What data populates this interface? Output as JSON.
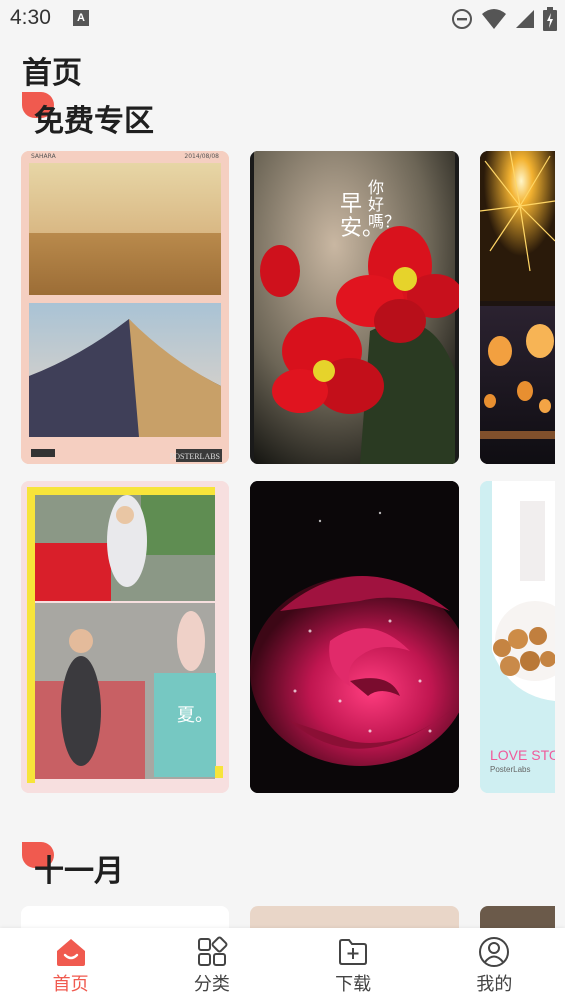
{
  "status_bar": {
    "time": "4:30",
    "left_icon": "A",
    "icons": [
      "do-not-disturb-icon",
      "wifi-icon",
      "signal-icon",
      "battery-charging-icon"
    ]
  },
  "page": {
    "title": "首页"
  },
  "sections": [
    {
      "title": "免费专区",
      "cards": [
        {
          "name": "desert-poster",
          "brand_text": "POSTERLABS",
          "header_left": "SAHARA",
          "header_right": "2014/08/08"
        },
        {
          "name": "red-flower-poster",
          "text_line1": "你好嗎？",
          "text_line2": "早安。"
        },
        {
          "name": "sparkler-lantern-poster"
        },
        {
          "name": "summer-street-poster",
          "text": "夏。"
        },
        {
          "name": "rose-poster"
        },
        {
          "name": "love-story-poster",
          "text_title": "LOVE STO",
          "text_sub": "PosterLabs"
        }
      ]
    },
    {
      "title": "十一月"
    }
  ],
  "bottom_nav": [
    {
      "label": "首页",
      "icon": "home-icon",
      "active": true
    },
    {
      "label": "分类",
      "icon": "category-grid-icon",
      "active": false
    },
    {
      "label": "下载",
      "icon": "download-folder-icon",
      "active": false
    },
    {
      "label": "我的",
      "icon": "profile-icon",
      "active": false
    }
  ],
  "colors": {
    "accent": "#f05a4f",
    "background": "#f5f5f5",
    "nav_inactive": "#444444"
  }
}
